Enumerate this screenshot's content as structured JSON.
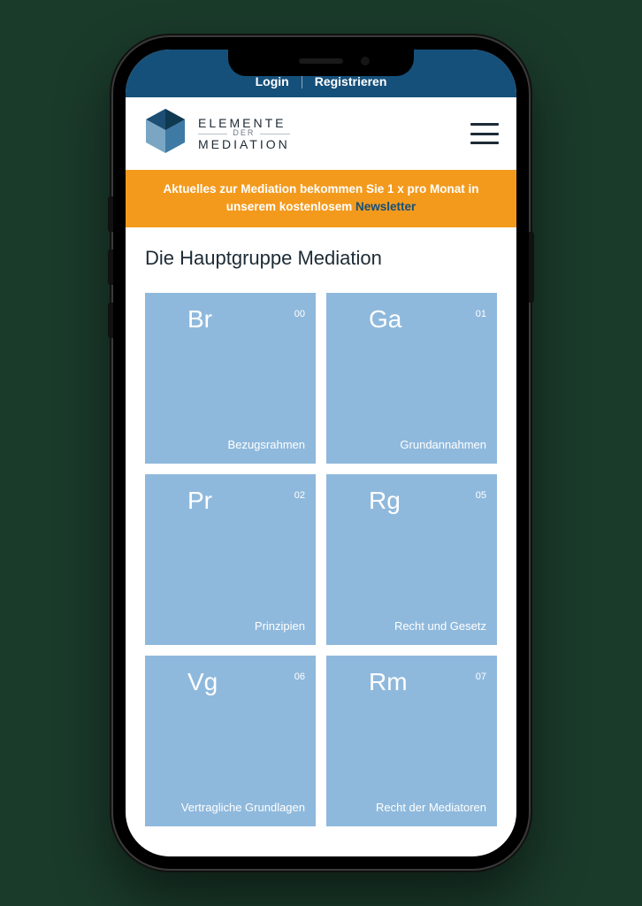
{
  "topbar": {
    "login": "Login",
    "register": "Registrieren"
  },
  "brand": {
    "line1": "ELEMENTE",
    "mid": "DER",
    "line2": "MEDIATION"
  },
  "banner": {
    "text_a": "Aktuelles zur Mediation bekommen Sie 1 x pro Monat in unserem kostenlosem ",
    "link": "Newsletter"
  },
  "page": {
    "title": "Die Hauptgruppe Mediation"
  },
  "tiles": [
    {
      "symbol": "Br",
      "num": "00",
      "label": "Bezugsrahmen"
    },
    {
      "symbol": "Ga",
      "num": "01",
      "label": "Grundannahmen"
    },
    {
      "symbol": "Pr",
      "num": "02",
      "label": "Prinzipien"
    },
    {
      "symbol": "Rg",
      "num": "05",
      "label": "Recht und Gesetz"
    },
    {
      "symbol": "Vg",
      "num": "06",
      "label": "Vertragliche Grundla­gen"
    },
    {
      "symbol": "Rm",
      "num": "07",
      "label": "Recht der Mediatoren"
    }
  ],
  "colors": {
    "topbar": "#15507a",
    "banner": "#f39a1d",
    "tile": "#8fb9dc"
  }
}
